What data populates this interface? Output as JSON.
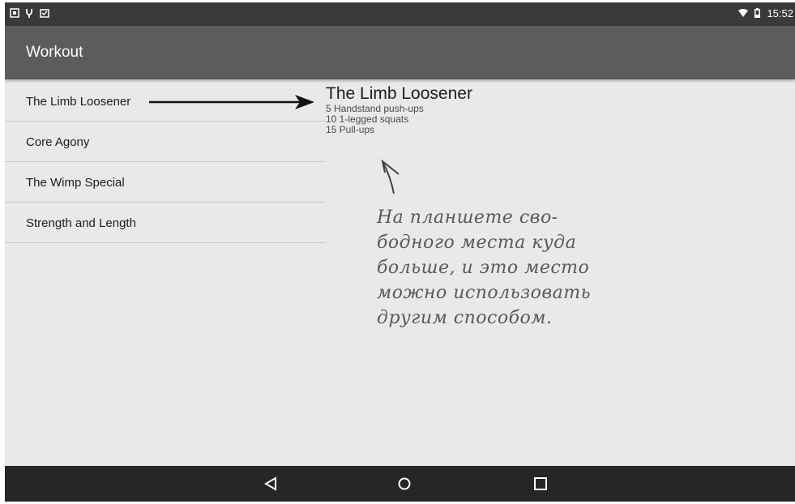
{
  "status_bar": {
    "time": "15:52",
    "left_icons": [
      "screenshot-icon",
      "usb-icon",
      "clipboard-icon"
    ],
    "right_icons": [
      "wifi-icon",
      "battery-icon"
    ]
  },
  "app_bar": {
    "title": "Workout"
  },
  "workouts": {
    "items": [
      {
        "label": "The Limb Loosener",
        "selected": true
      },
      {
        "label": "Core Agony"
      },
      {
        "label": "The Wimp Special"
      },
      {
        "label": "Strength and Length"
      }
    ]
  },
  "detail": {
    "title": "The Limb Loosener",
    "lines": [
      "5 Handstand push-ups",
      "10 1-legged squats",
      "15 Pull-ups"
    ]
  },
  "annotation": {
    "lines": [
      "На планшете сво-",
      "бодного места куда",
      "больше, и это место",
      "можно использовать",
      "другим способом."
    ]
  },
  "nav_bar": {
    "buttons": [
      "back-icon",
      "home-icon",
      "recents-icon"
    ]
  },
  "colors": {
    "status_bar": "#3a3a3a",
    "app_bar": "#5c5c5c",
    "background": "#e9e9ea",
    "nav_bar": "#262626"
  }
}
